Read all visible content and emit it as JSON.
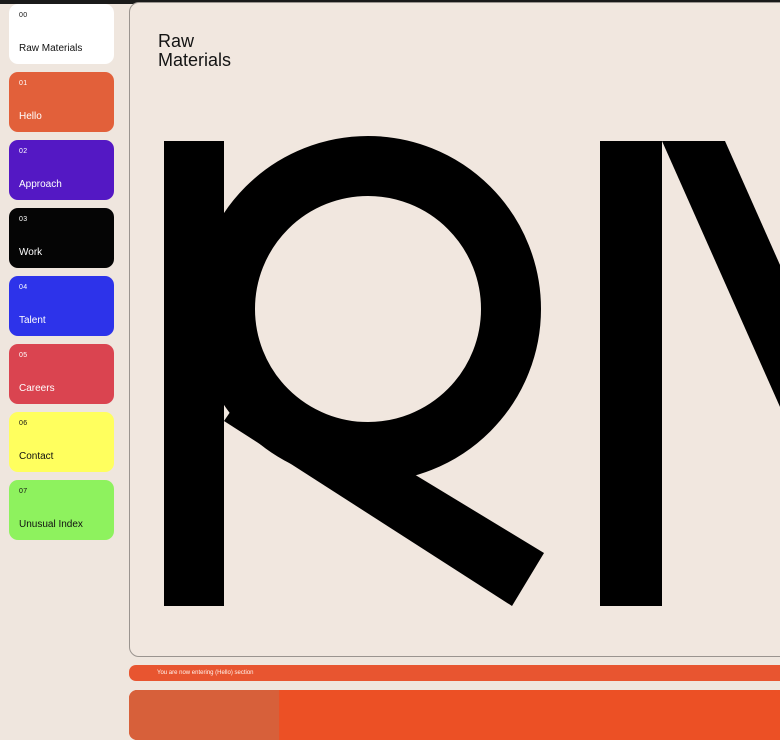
{
  "brand": {
    "title": "Raw\nMaterials"
  },
  "nav": {
    "items": [
      {
        "num": "00",
        "label": "Raw Materials",
        "bg": "#ffffff",
        "fg": "#111111"
      },
      {
        "num": "01",
        "label": "Hello",
        "bg": "#e2603a",
        "fg": "#ffffff"
      },
      {
        "num": "02",
        "label": "Approach",
        "bg": "#5418c4",
        "fg": "#ffffff"
      },
      {
        "num": "03",
        "label": "Work",
        "bg": "#050505",
        "fg": "#ffffff"
      },
      {
        "num": "04",
        "label": "Talent",
        "bg": "#2d33ea",
        "fg": "#ffffff"
      },
      {
        "num": "05",
        "label": "Careers",
        "bg": "#da4450",
        "fg": "#ffffff"
      },
      {
        "num": "06",
        "label": "Contact",
        "bg": "#ffff5e",
        "fg": "#111111"
      },
      {
        "num": "07",
        "label": "Unusual Index",
        "bg": "#8ef25e",
        "fg": "#111111"
      }
    ]
  },
  "status": {
    "text": "You are now entering (Hello) section"
  },
  "colors": {
    "accent": "#e85530",
    "background": "#efe6de",
    "ink": "#000000"
  }
}
